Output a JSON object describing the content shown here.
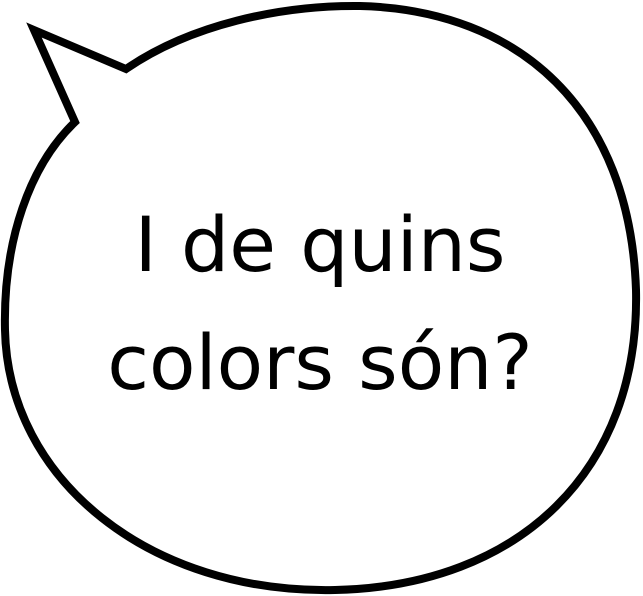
{
  "speech_bubble": {
    "line1": "I de quins",
    "line2": "colors són?"
  },
  "colors": {
    "background": "#ffffff",
    "outline": "#000000",
    "text": "#000000"
  }
}
